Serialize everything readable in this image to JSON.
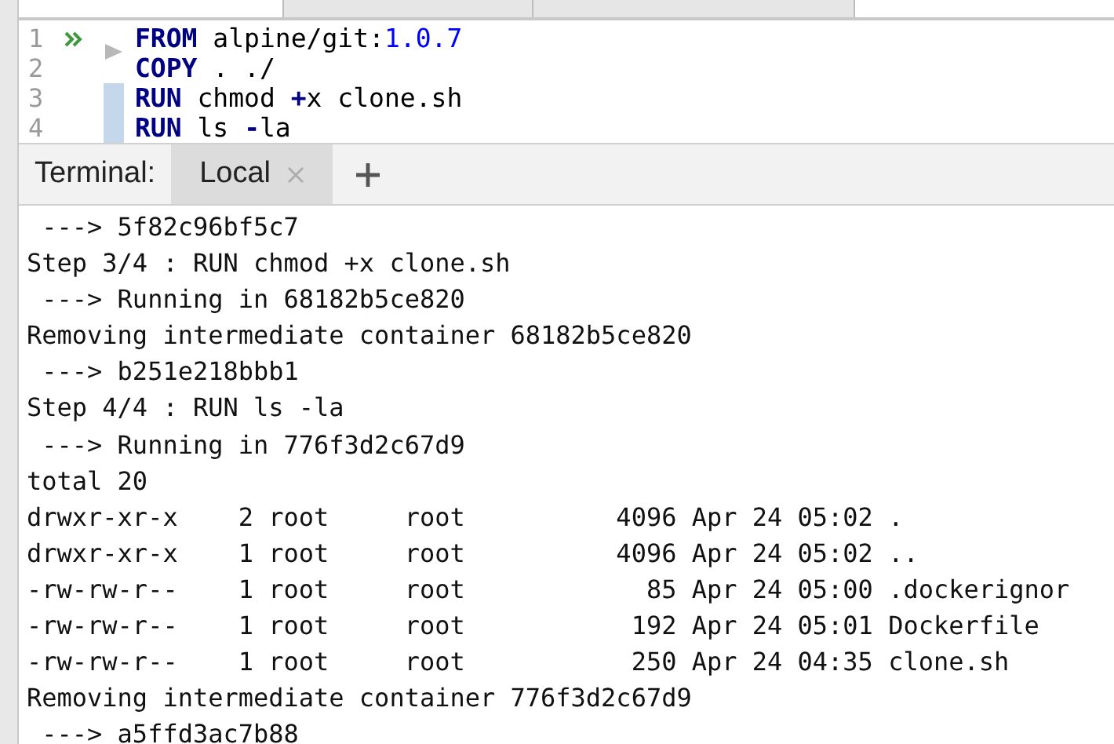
{
  "editor": {
    "lines": [
      {
        "number": "1",
        "runnable": true,
        "changed": false,
        "tokens": [
          {
            "kind": "keyword",
            "text": "FROM"
          },
          {
            "kind": "plain",
            "text": " alpine/git:"
          },
          {
            "kind": "number",
            "text": "1.0.7"
          }
        ]
      },
      {
        "number": "2",
        "runnable": false,
        "changed": false,
        "tokens": [
          {
            "kind": "keyword",
            "text": "COPY"
          },
          {
            "kind": "plain",
            "text": " . ./"
          }
        ]
      },
      {
        "number": "3",
        "runnable": false,
        "changed": true,
        "tokens": [
          {
            "kind": "keyword",
            "text": "RUN"
          },
          {
            "kind": "plain",
            "text": " chmod "
          },
          {
            "kind": "operator",
            "text": "+"
          },
          {
            "kind": "plain",
            "text": "x clone.sh"
          }
        ]
      },
      {
        "number": "4",
        "runnable": false,
        "changed": true,
        "tokens": [
          {
            "kind": "keyword",
            "text": "RUN"
          },
          {
            "kind": "plain",
            "text": " ls "
          },
          {
            "kind": "operator",
            "text": "-"
          },
          {
            "kind": "plain",
            "text": "la"
          }
        ]
      }
    ]
  },
  "terminal": {
    "title": "Terminal:",
    "tabs": [
      {
        "label": "Local",
        "selected": true
      }
    ],
    "output": [
      " ---> 5f82c96bf5c7",
      "Step 3/4 : RUN chmod +x clone.sh",
      " ---> Running in 68182b5ce820",
      "Removing intermediate container 68182b5ce820",
      " ---> b251e218bbb1",
      "Step 4/4 : RUN ls -la",
      " ---> Running in 776f3d2c67d9",
      "total 20",
      "drwxr-xr-x    2 root     root          4096 Apr 24 05:02 .",
      "drwxr-xr-x    1 root     root          4096 Apr 24 05:02 ..",
      "-rw-rw-r--    1 root     root            85 Apr 24 05:00 .dockerignor",
      "-rw-rw-r--    1 root     root           192 Apr 24 05:01 Dockerfile",
      "-rw-rw-r--    1 root     root           250 Apr 24 04:35 clone.sh",
      "Removing intermediate container 776f3d2c67d9",
      " ---> a5ffd3ac7b88"
    ]
  }
}
